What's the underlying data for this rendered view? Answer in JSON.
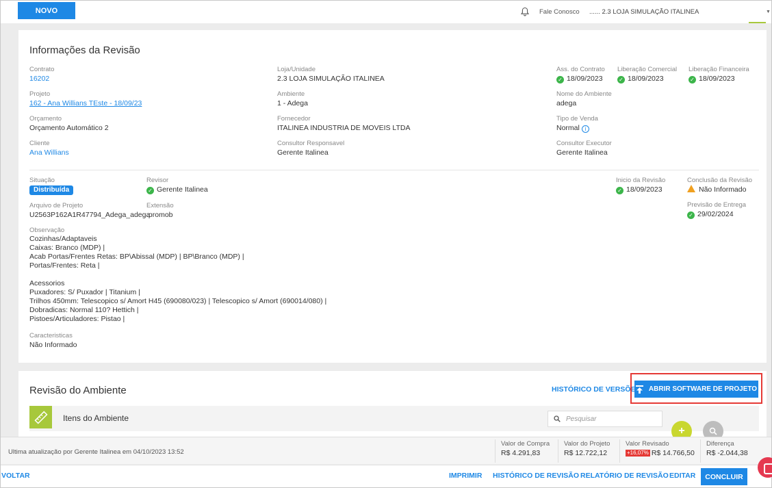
{
  "topbar": {
    "novo_label": "NOVO",
    "fale_conosco": "Fale Conosco",
    "loja": "...... 2.3 LOJA SIMULAÇÃO ITALINEA"
  },
  "info": {
    "title": "Informações da Revisão",
    "contrato": {
      "label": "Contrato",
      "value": "16202"
    },
    "loja_unidade": {
      "label": "Loja/Unidade",
      "value": "2.3 LOJA SIMULAÇÃO ITALINEA"
    },
    "ass_contrato": {
      "label": "Ass. do Contrato",
      "value": "18/09/2023"
    },
    "lib_comercial": {
      "label": "Liberação Comercial",
      "value": "18/09/2023"
    },
    "lib_financeira": {
      "label": "Liberação Financeira",
      "value": "18/09/2023"
    },
    "projeto": {
      "label": "Projeto",
      "value": "162 - Ana Willians TEste - 18/09/23"
    },
    "ambiente": {
      "label": "Ambiente",
      "value": "1 - Adega"
    },
    "nome_ambiente": {
      "label": "Nome do Ambiente",
      "value": "adega"
    },
    "orcamento": {
      "label": "Orçamento",
      "value": "Orçamento Automático 2"
    },
    "fornecedor": {
      "label": "Fornecedor",
      "value": "ITALINEA INDUSTRIA DE MOVEIS LTDA"
    },
    "tipo_venda": {
      "label": "Tipo de Venda",
      "value": "Normal"
    },
    "cliente": {
      "label": "Cliente",
      "value": "Ana Willians"
    },
    "consultor_resp": {
      "label": "Consultor Responsavel",
      "value": "Gerente Italinea"
    },
    "consultor_exec": {
      "label": "Consultor Executor",
      "value": "Gerente Italinea"
    },
    "situacao": {
      "label": "Situação",
      "value": "Distribuída"
    },
    "revisor": {
      "label": "Revisor",
      "value": "Gerente Italinea"
    },
    "inicio_revisao": {
      "label": "Inicio da Revisão",
      "value": "18/09/2023"
    },
    "conclusao_revisao": {
      "label": "Conclusão da Revisão",
      "value": "Não Informado"
    },
    "arquivo": {
      "label": "Arquivo de Projeto",
      "value": "U2563P162A1R47794_Adega_adega"
    },
    "extensao": {
      "label": "Extensão",
      "value": ".promob"
    },
    "previsao_entrega": {
      "label": "Previsão de Entrega",
      "value": "29/02/2024"
    },
    "observacao": {
      "label": "Observação",
      "lines1": "Cozinhas/Adaptaveis\nCaixas: Branco (MDP) |\nAcab Portas/Frentes Retas: BP\\Abissal (MDP) | BP\\Branco (MDP) |\nPortas/Frentes: Reta |",
      "lines2": "Acessorios\nPuxadores: S/ Puxador | Titanium |\nTrilhos 450mm: Telescopico s/ Amort H45 (690080/023) | Telescopico s/ Amort (690014/080) |\nDobradicas: Normal 110? Hettich |\nPistoes/Articuladores: Pistao |"
    },
    "caracteristicas": {
      "label": "Caracteristicas",
      "value": "Não Informado"
    }
  },
  "revisao": {
    "title": "Revisão do Ambiente",
    "historico_versoes": "HISTÓRICO DE VERSÕES",
    "abrir_software": "ABRIR SOFTWARE DE PROJETO",
    "itens_title": "Itens do Ambiente",
    "search_placeholder": "Pesquisar"
  },
  "summary": {
    "last_update": "Ultima atualização por Gerente Italinea em 04/10/2023 13:52",
    "valor_compra": {
      "label": "Valor de Compra",
      "value": "R$ 4.291,83"
    },
    "valor_projeto": {
      "label": "Valor do Projeto",
      "value": "R$ 12.722,12"
    },
    "valor_revisado": {
      "label": "Valor Revisado",
      "pct": "+16,07%",
      "value": "R$ 14.766,50"
    },
    "diferenca": {
      "label": "Diferença",
      "value": "R$ -2.044,38"
    }
  },
  "actions": {
    "voltar": "VOLTAR",
    "imprimir": "IMPRIMIR",
    "historico_revisao": "HISTÓRICO DE REVISÃO",
    "relatorio_revisao": "RELATÓRIO DE REVISÃO",
    "editar": "EDITAR",
    "concluir": "CONCLUIR"
  },
  "colors": {
    "primary": "#1e88e5",
    "success": "#3cb54a",
    "accent_green": "#a7c83b",
    "danger": "#e53935"
  }
}
